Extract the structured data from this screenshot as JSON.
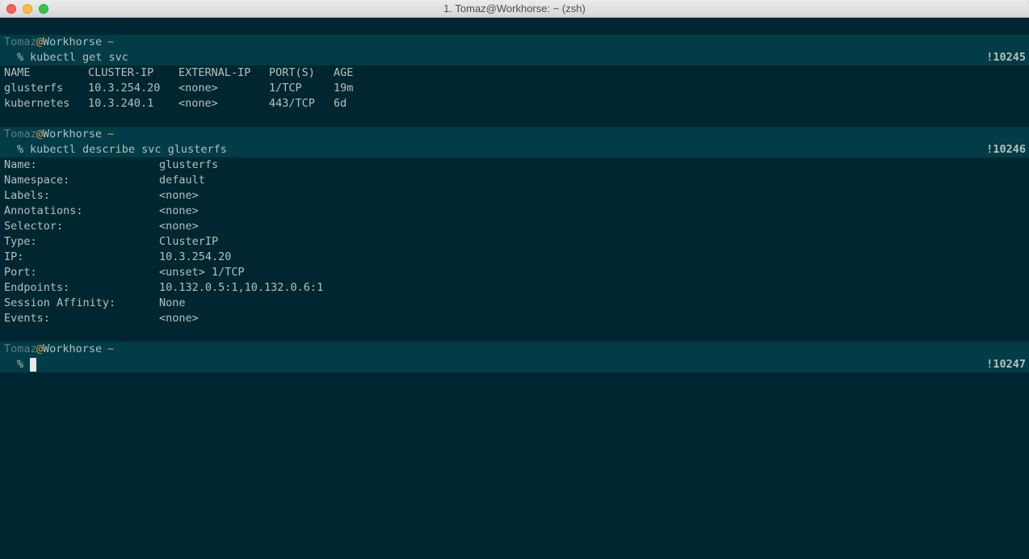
{
  "window": {
    "title": "1. Tomaz@Workhorse: ~ (zsh)"
  },
  "prompt": {
    "user": "Tomaz",
    "at": "@",
    "host": "Workhorse",
    "dir": "~",
    "symbol": "%"
  },
  "blocks": [
    {
      "command": "kubectl get svc",
      "history": "!10245",
      "table": {
        "headers": [
          "NAME",
          "CLUSTER-IP",
          "EXTERNAL-IP",
          "PORT(S)",
          "AGE"
        ],
        "rows": [
          [
            "glusterfs",
            "10.3.254.20",
            "<none>",
            "1/TCP",
            "19m"
          ],
          [
            "kubernetes",
            "10.3.240.1",
            "<none>",
            "443/TCP",
            "6d"
          ]
        ]
      }
    },
    {
      "command": "kubectl describe svc glusterfs",
      "history": "!10246",
      "fields": [
        {
          "key": "Name:",
          "value": "glusterfs"
        },
        {
          "key": "Namespace:",
          "value": "default"
        },
        {
          "key": "Labels:",
          "value": "<none>"
        },
        {
          "key": "Annotations:",
          "value": "<none>"
        },
        {
          "key": "Selector:",
          "value": "<none>"
        },
        {
          "key": "Type:",
          "value": "ClusterIP"
        },
        {
          "key": "IP:",
          "value": "10.3.254.20"
        },
        {
          "key": "Port:",
          "value": "<unset> 1/TCP"
        },
        {
          "key": "Endpoints:",
          "value": "10.132.0.5:1,10.132.0.6:1"
        },
        {
          "key": "Session Affinity:",
          "value": "None"
        },
        {
          "key": "Events:",
          "value": "<none>"
        }
      ]
    },
    {
      "command": "",
      "history": "!10247"
    }
  ],
  "colors": {
    "background": "#002731",
    "highlight_line": "#023c46",
    "text": "#b4bfbf",
    "accent": "#d4a44a",
    "user_dim": "#5d7b80"
  }
}
